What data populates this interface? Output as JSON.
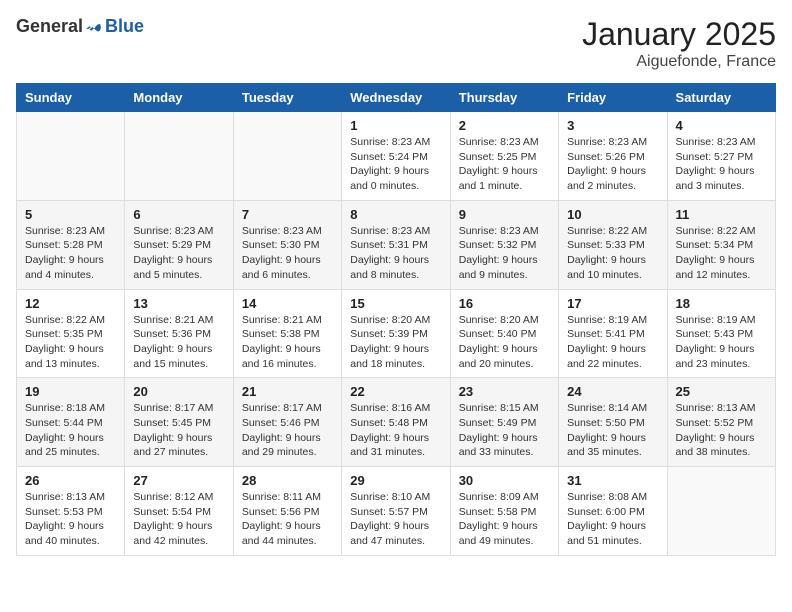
{
  "logo": {
    "general": "General",
    "blue": "Blue"
  },
  "header": {
    "month": "January 2025",
    "location": "Aiguefonde, France"
  },
  "weekdays": [
    "Sunday",
    "Monday",
    "Tuesday",
    "Wednesday",
    "Thursday",
    "Friday",
    "Saturday"
  ],
  "weeks": [
    [
      {
        "day": "",
        "info": ""
      },
      {
        "day": "",
        "info": ""
      },
      {
        "day": "",
        "info": ""
      },
      {
        "day": "1",
        "info": "Sunrise: 8:23 AM\nSunset: 5:24 PM\nDaylight: 9 hours\nand 0 minutes."
      },
      {
        "day": "2",
        "info": "Sunrise: 8:23 AM\nSunset: 5:25 PM\nDaylight: 9 hours\nand 1 minute."
      },
      {
        "day": "3",
        "info": "Sunrise: 8:23 AM\nSunset: 5:26 PM\nDaylight: 9 hours\nand 2 minutes."
      },
      {
        "day": "4",
        "info": "Sunrise: 8:23 AM\nSunset: 5:27 PM\nDaylight: 9 hours\nand 3 minutes."
      }
    ],
    [
      {
        "day": "5",
        "info": "Sunrise: 8:23 AM\nSunset: 5:28 PM\nDaylight: 9 hours\nand 4 minutes."
      },
      {
        "day": "6",
        "info": "Sunrise: 8:23 AM\nSunset: 5:29 PM\nDaylight: 9 hours\nand 5 minutes."
      },
      {
        "day": "7",
        "info": "Sunrise: 8:23 AM\nSunset: 5:30 PM\nDaylight: 9 hours\nand 6 minutes."
      },
      {
        "day": "8",
        "info": "Sunrise: 8:23 AM\nSunset: 5:31 PM\nDaylight: 9 hours\nand 8 minutes."
      },
      {
        "day": "9",
        "info": "Sunrise: 8:23 AM\nSunset: 5:32 PM\nDaylight: 9 hours\nand 9 minutes."
      },
      {
        "day": "10",
        "info": "Sunrise: 8:22 AM\nSunset: 5:33 PM\nDaylight: 9 hours\nand 10 minutes."
      },
      {
        "day": "11",
        "info": "Sunrise: 8:22 AM\nSunset: 5:34 PM\nDaylight: 9 hours\nand 12 minutes."
      }
    ],
    [
      {
        "day": "12",
        "info": "Sunrise: 8:22 AM\nSunset: 5:35 PM\nDaylight: 9 hours\nand 13 minutes."
      },
      {
        "day": "13",
        "info": "Sunrise: 8:21 AM\nSunset: 5:36 PM\nDaylight: 9 hours\nand 15 minutes."
      },
      {
        "day": "14",
        "info": "Sunrise: 8:21 AM\nSunset: 5:38 PM\nDaylight: 9 hours\nand 16 minutes."
      },
      {
        "day": "15",
        "info": "Sunrise: 8:20 AM\nSunset: 5:39 PM\nDaylight: 9 hours\nand 18 minutes."
      },
      {
        "day": "16",
        "info": "Sunrise: 8:20 AM\nSunset: 5:40 PM\nDaylight: 9 hours\nand 20 minutes."
      },
      {
        "day": "17",
        "info": "Sunrise: 8:19 AM\nSunset: 5:41 PM\nDaylight: 9 hours\nand 22 minutes."
      },
      {
        "day": "18",
        "info": "Sunrise: 8:19 AM\nSunset: 5:43 PM\nDaylight: 9 hours\nand 23 minutes."
      }
    ],
    [
      {
        "day": "19",
        "info": "Sunrise: 8:18 AM\nSunset: 5:44 PM\nDaylight: 9 hours\nand 25 minutes."
      },
      {
        "day": "20",
        "info": "Sunrise: 8:17 AM\nSunset: 5:45 PM\nDaylight: 9 hours\nand 27 minutes."
      },
      {
        "day": "21",
        "info": "Sunrise: 8:17 AM\nSunset: 5:46 PM\nDaylight: 9 hours\nand 29 minutes."
      },
      {
        "day": "22",
        "info": "Sunrise: 8:16 AM\nSunset: 5:48 PM\nDaylight: 9 hours\nand 31 minutes."
      },
      {
        "day": "23",
        "info": "Sunrise: 8:15 AM\nSunset: 5:49 PM\nDaylight: 9 hours\nand 33 minutes."
      },
      {
        "day": "24",
        "info": "Sunrise: 8:14 AM\nSunset: 5:50 PM\nDaylight: 9 hours\nand 35 minutes."
      },
      {
        "day": "25",
        "info": "Sunrise: 8:13 AM\nSunset: 5:52 PM\nDaylight: 9 hours\nand 38 minutes."
      }
    ],
    [
      {
        "day": "26",
        "info": "Sunrise: 8:13 AM\nSunset: 5:53 PM\nDaylight: 9 hours\nand 40 minutes."
      },
      {
        "day": "27",
        "info": "Sunrise: 8:12 AM\nSunset: 5:54 PM\nDaylight: 9 hours\nand 42 minutes."
      },
      {
        "day": "28",
        "info": "Sunrise: 8:11 AM\nSunset: 5:56 PM\nDaylight: 9 hours\nand 44 minutes."
      },
      {
        "day": "29",
        "info": "Sunrise: 8:10 AM\nSunset: 5:57 PM\nDaylight: 9 hours\nand 47 minutes."
      },
      {
        "day": "30",
        "info": "Sunrise: 8:09 AM\nSunset: 5:58 PM\nDaylight: 9 hours\nand 49 minutes."
      },
      {
        "day": "31",
        "info": "Sunrise: 8:08 AM\nSunset: 6:00 PM\nDaylight: 9 hours\nand 51 minutes."
      },
      {
        "day": "",
        "info": ""
      }
    ]
  ]
}
